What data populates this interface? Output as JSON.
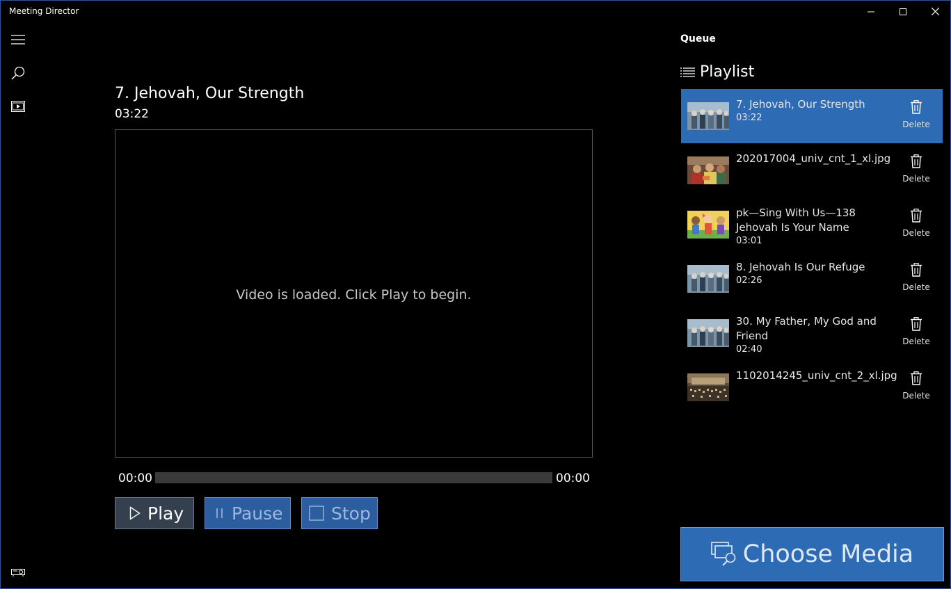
{
  "window": {
    "title": "Meeting Director"
  },
  "nav": {
    "items": [
      {
        "icon": "hamburger-menu-icon"
      },
      {
        "icon": "search-icon"
      },
      {
        "icon": "media-icon"
      }
    ],
    "bottom_icon": "projector-icon"
  },
  "player": {
    "title": "7. Jehovah, Our Strength",
    "duration": "03:22",
    "message": "Video is loaded.  Click Play to begin.",
    "time_start": "00:00",
    "time_end": "00:00",
    "progress": 0,
    "buttons": {
      "play": "Play",
      "pause": "Pause",
      "stop": "Stop"
    }
  },
  "queue": {
    "label": "Queue",
    "playlist_title": "Playlist",
    "delete_label": "Delete",
    "items": [
      {
        "name": "7. Jehovah, Our Strength",
        "duration": "03:22",
        "selected": true,
        "thumb": "song"
      },
      {
        "name": "202017004_univ_cnt_1_xl.jpg",
        "duration": "",
        "selected": false,
        "thumb": "photo-colorful"
      },
      {
        "name": "pk—Sing With Us—138 Jehovah Is Your Name",
        "duration": "03:01",
        "selected": false,
        "thumb": "cartoon"
      },
      {
        "name": "8. Jehovah Is Our Refuge",
        "duration": "02:26",
        "selected": false,
        "thumb": "song"
      },
      {
        "name": "30. My Father, My God and Friend",
        "duration": "02:40",
        "selected": false,
        "thumb": "song"
      },
      {
        "name": "1102014245_univ_cnt_2_xl.jpg",
        "duration": "",
        "selected": false,
        "thumb": "photo-sepia"
      }
    ]
  },
  "choose_media": {
    "label": "Choose Media"
  },
  "colors": {
    "accent": "#2e6bb5",
    "background": "#000000",
    "track": "#3a3a3a"
  }
}
